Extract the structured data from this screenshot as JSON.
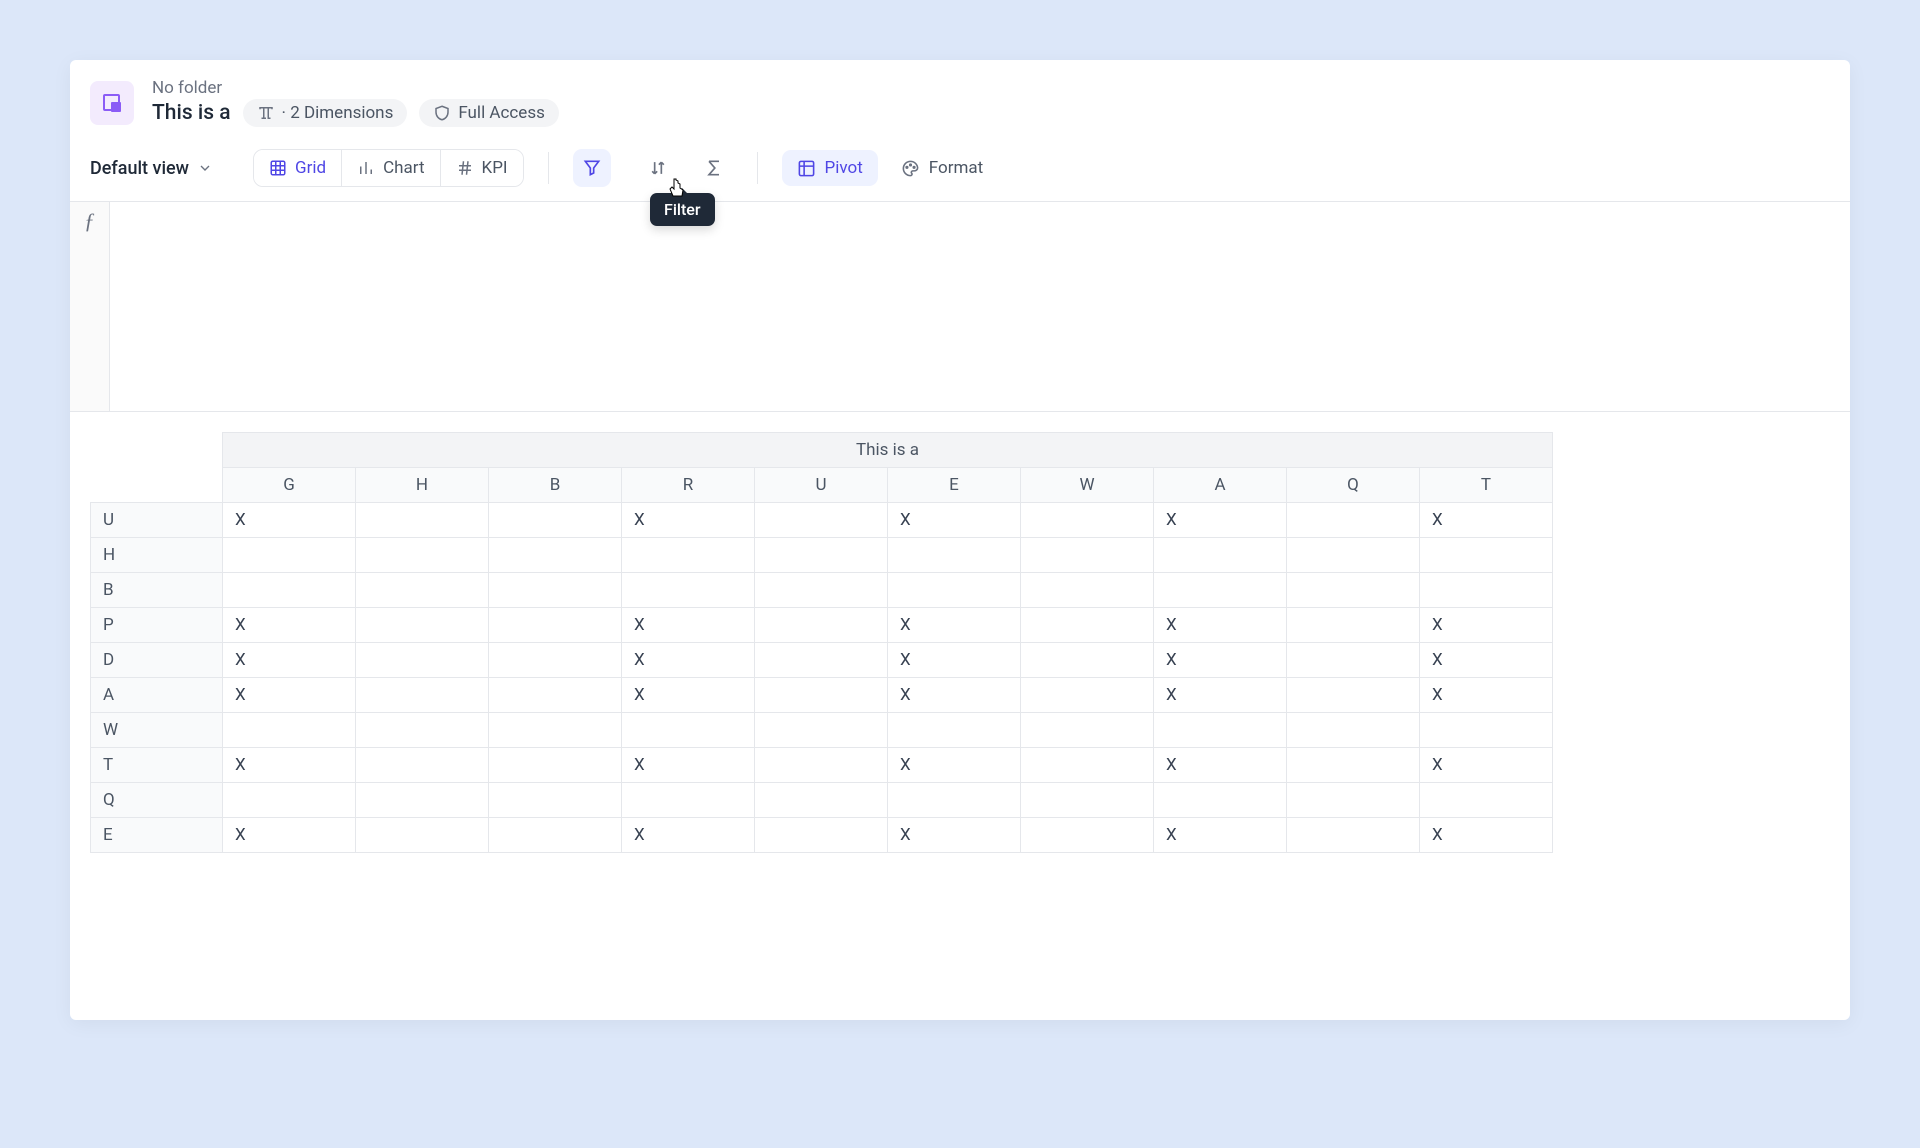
{
  "header": {
    "folder_label": "No folder",
    "title": "This is a",
    "dimensions_badge": "· 2 Dimensions",
    "access_badge": "Full Access"
  },
  "toolbar": {
    "view_label": "Default view",
    "grid_label": "Grid",
    "chart_label": "Chart",
    "kpi_label": "KPI",
    "pivot_label": "Pivot",
    "format_label": "Format",
    "filter_tooltip": "Filter"
  },
  "formula": {
    "symbol": "ƒ"
  },
  "pivot_table": {
    "title": "This is a",
    "columns": [
      "G",
      "H",
      "B",
      "R",
      "U",
      "E",
      "W",
      "A",
      "Q",
      "T"
    ],
    "rows": [
      {
        "label": "U",
        "cells": [
          "X",
          "",
          "",
          "X",
          "",
          "X",
          "",
          "X",
          "",
          "X"
        ]
      },
      {
        "label": "H",
        "cells": [
          "",
          "",
          "",
          "",
          "",
          "",
          "",
          "",
          "",
          ""
        ]
      },
      {
        "label": "B",
        "cells": [
          "",
          "",
          "",
          "",
          "",
          "",
          "",
          "",
          "",
          ""
        ]
      },
      {
        "label": "P",
        "cells": [
          "X",
          "",
          "",
          "X",
          "",
          "X",
          "",
          "X",
          "",
          "X"
        ]
      },
      {
        "label": "D",
        "cells": [
          "X",
          "",
          "",
          "X",
          "",
          "X",
          "",
          "X",
          "",
          "X"
        ]
      },
      {
        "label": "A",
        "cells": [
          "X",
          "",
          "",
          "X",
          "",
          "X",
          "",
          "X",
          "",
          "X"
        ]
      },
      {
        "label": "W",
        "cells": [
          "",
          "",
          "",
          "",
          "",
          "",
          "",
          "",
          "",
          ""
        ]
      },
      {
        "label": "T",
        "cells": [
          "X",
          "",
          "",
          "X",
          "",
          "X",
          "",
          "X",
          "",
          "X"
        ]
      },
      {
        "label": "Q",
        "cells": [
          "",
          "",
          "",
          "",
          "",
          "",
          "",
          "",
          "",
          ""
        ]
      },
      {
        "label": "E",
        "cells": [
          "X",
          "",
          "",
          "X",
          "",
          "X",
          "",
          "X",
          "",
          "X"
        ]
      }
    ]
  }
}
